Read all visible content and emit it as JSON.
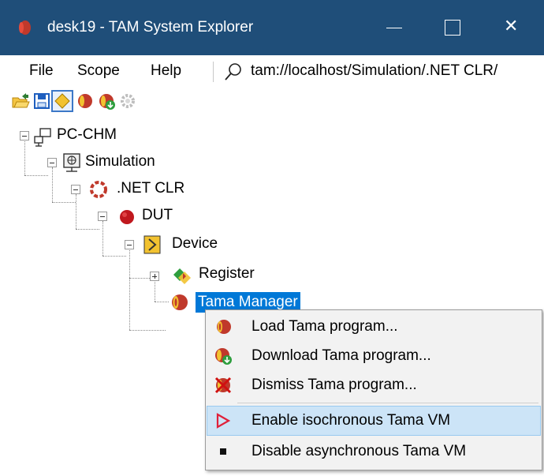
{
  "window": {
    "title": "desk19 - TAM System Explorer",
    "titlebar_color": "#1f4e79",
    "icon": "tama-icon",
    "controls": {
      "minimize_icon": "minimize-icon",
      "maximize_icon": "maximize-icon",
      "close_symbol": "✕"
    }
  },
  "menu": {
    "items": [
      "File",
      "Scope",
      "Help"
    ],
    "address": "tam://localhost/Simulation/.NET CLR/"
  },
  "toolbar": {
    "buttons": [
      "open-folder-icon",
      "save-icon",
      "diamond-icon",
      "tama-icon",
      "download-tama-icon",
      "gear-icon"
    ]
  },
  "tree": {
    "nodes": [
      {
        "label": "PC-CHM",
        "icon": "computer-icon",
        "expanded": true
      },
      {
        "label": "Simulation",
        "icon": "simulation-icon",
        "expanded": true
      },
      {
        "label": ".NET CLR",
        "icon": "clr-icon",
        "expanded": true
      },
      {
        "label": "DUT",
        "icon": "dut-icon",
        "expanded": true
      },
      {
        "label": "Device",
        "icon": "device-icon",
        "expanded": true
      },
      {
        "label": "Register",
        "icon": "register-icon",
        "expanded": false
      },
      {
        "label": "Tama Manager",
        "icon": "tama-icon",
        "selected": true
      }
    ],
    "selection_color": "#0078d7"
  },
  "context_menu": {
    "items": [
      {
        "label": "Load Tama program...",
        "icon": "tama-icon"
      },
      {
        "label": "Download Tama program...",
        "icon": "download-tama-icon"
      },
      {
        "label": "Dismiss Tama program...",
        "icon": "dismiss-tama-icon"
      },
      {
        "label": "Enable isochronous Tama VM",
        "icon": "play-icon",
        "highlighted": true
      },
      {
        "label": "Disable asynchronous Tama VM",
        "icon": "stop-icon"
      }
    ],
    "highlight_color": "#cce4f7"
  }
}
